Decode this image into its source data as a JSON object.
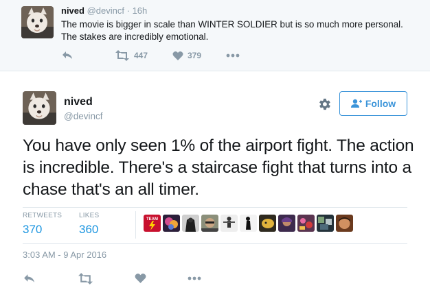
{
  "parent_tweet": {
    "name": "nived",
    "handle": "@devincf",
    "separator": "·",
    "time": "16h",
    "text": "The movie is bigger in scale than WINTER SOLDIER but is so much more personal. The stakes are incredibly emotional.",
    "actions": {
      "reply_icon": "reply-icon",
      "retweet_icon": "retweet-icon",
      "retweet_count": "447",
      "like_icon": "heart-icon",
      "like_count": "379",
      "more_icon": "more-icon"
    }
  },
  "main_tweet": {
    "name": "nived",
    "handle": "@devincf",
    "settings_icon": "gear-icon",
    "follow_label": "Follow",
    "text": "You have only seen 1% of the airport fight. The action is incredible. There's a staircase fight that turns into a chase that's an all timer.",
    "stats": {
      "retweets_label": "RETWEETS",
      "retweets_value": "370",
      "likes_label": "LIKES",
      "likes_value": "360"
    },
    "liker_avatars": [
      "TEAM",
      "",
      "",
      "",
      "",
      "",
      "",
      "",
      "",
      "",
      ""
    ],
    "timestamp": "3:03 AM - 9 Apr 2016",
    "actions": [
      "reply-icon",
      "retweet-icon",
      "heart-icon",
      "more-icon"
    ]
  },
  "colors": {
    "accent": "#1b95e0",
    "follow_border": "#3b94d9",
    "muted": "#8899a6",
    "parent_bg": "#f5f8fa",
    "divider": "#e1e8ed"
  }
}
